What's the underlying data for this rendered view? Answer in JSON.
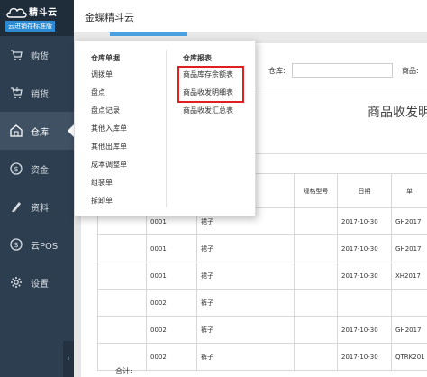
{
  "brand": {
    "name": "精斗云",
    "subtitle": "云进销存标准版"
  },
  "topbar": {
    "title": "金蝶精斗云"
  },
  "sidebar": {
    "items": [
      {
        "label": "购货",
        "icon": "cart-icon"
      },
      {
        "label": "销货",
        "icon": "cart-out-icon"
      },
      {
        "label": "仓库",
        "icon": "warehouse-icon",
        "active": true
      },
      {
        "label": "资金",
        "icon": "money-icon"
      },
      {
        "label": "资料",
        "icon": "pencil-icon"
      },
      {
        "label": "云POS",
        "icon": "pos-icon"
      },
      {
        "label": "设置",
        "icon": "gear-icon"
      }
    ],
    "collapse_label": "‹"
  },
  "menu": {
    "col1_header": "仓库单据",
    "col1_items": [
      "调拨单",
      "盘点",
      "盘点记录",
      "其他入库单",
      "其他出库单",
      "成本调整单",
      "组装单",
      "拆卸单"
    ],
    "col2_header": "仓库报表",
    "col2_items": [
      "商品库存余额表",
      "商品收发明细表",
      "商品收发汇总表"
    ]
  },
  "filters": {
    "warehouse_label": "仓库:",
    "product_label": "商品:",
    "warehouse_value": "",
    "product_value": ""
  },
  "report": {
    "title": "商品收发明"
  },
  "table": {
    "headers": [
      "",
      "",
      "称",
      "规格型号",
      "日期",
      "单"
    ],
    "rows": [
      [
        "",
        "0001",
        "裙子",
        "",
        "2017-10-30",
        "GH2017"
      ],
      [
        "",
        "0001",
        "裙子",
        "",
        "2017-10-30",
        "GH2017"
      ],
      [
        "",
        "0001",
        "裙子",
        "",
        "2017-10-30",
        "XH2017"
      ],
      [
        "",
        "0002",
        "裤子",
        "",
        "",
        ""
      ],
      [
        "",
        "0002",
        "裤子",
        "",
        "2017-10-30",
        "GH2017"
      ],
      [
        "",
        "0002",
        "裤子",
        "",
        "2017-10-30",
        "QTRK201"
      ]
    ],
    "total_label": "合计:"
  },
  "colors": {
    "sidebar_bg": "#2c3e50",
    "accent": "#4aa0e0",
    "highlight": "#e02020"
  }
}
